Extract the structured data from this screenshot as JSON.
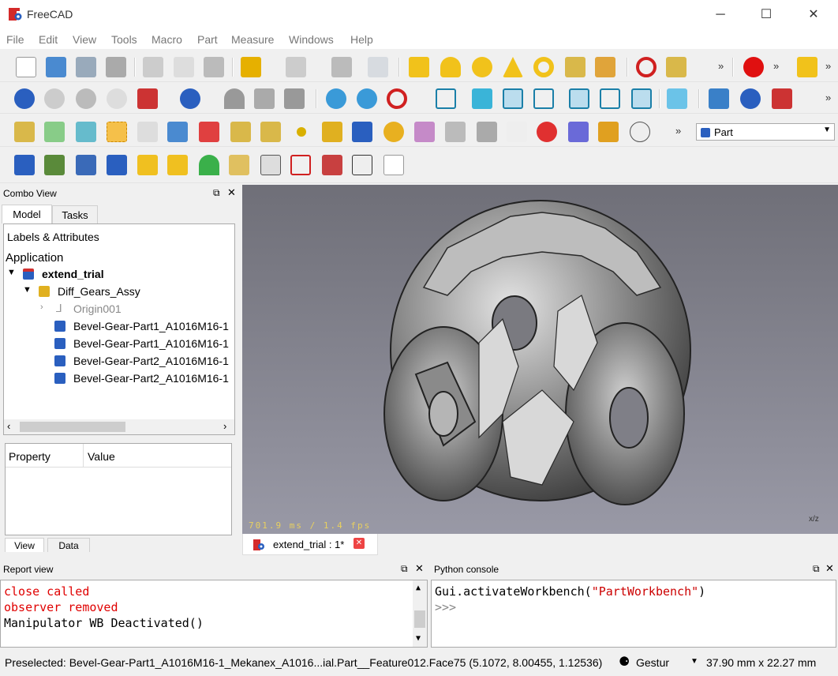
{
  "app": {
    "title": "FreeCAD"
  },
  "menu": [
    "File",
    "Edit",
    "View",
    "Tools",
    "Macro",
    "Part",
    "Measure",
    "Windows",
    "Help"
  ],
  "toolbar": {
    "workbench_selector": "Part",
    "overflow": "»"
  },
  "combo_view": {
    "title": "Combo View",
    "tabs": [
      "Model",
      "Tasks"
    ],
    "labels_header": "Labels & Attributes",
    "application_label": "Application",
    "tree": {
      "document": "extend_trial",
      "assembly": "Diff_Gears_Assy",
      "origin": "Origin001",
      "parts": [
        "Bevel-Gear-Part1_A1016M16-1",
        "Bevel-Gear-Part1_A1016M16-1",
        "Bevel-Gear-Part2_A1016M16-1",
        "Bevel-Gear-Part2_A1016M16-1"
      ]
    },
    "property_columns": [
      "Property",
      "Value"
    ],
    "bottom_tabs": [
      "View",
      "Data"
    ]
  },
  "viewport": {
    "fps": "701.9 ms / 1.4 fps",
    "axis": "x/z",
    "doc_tab": "extend_trial : 1*"
  },
  "report_view": {
    "title": "Report view",
    "lines": [
      "close called",
      "observer removed",
      "Manipulator WB Deactivated()"
    ],
    "colors": [
      "#e00000",
      "#e00000",
      "#000000"
    ]
  },
  "python_console": {
    "title": "Python console",
    "prefix": "Gui.activateWorkbench(",
    "string": "\"PartWorkbench\"",
    "suffix": ")",
    "prompt": ">>>"
  },
  "status": {
    "preselected": "Preselected: Bevel-Gear-Part1_A1016M16-1_Mekanex_A1016...ial.Part__Feature012.Face75 (5.1072, 8.00455, 1.12536)",
    "nav_style": "Gestur",
    "dimensions": "37.90 mm x 22.27 mm"
  },
  "colors": {
    "accent": "#1e6fd0",
    "error": "#e00000",
    "string": "#cc0000"
  }
}
